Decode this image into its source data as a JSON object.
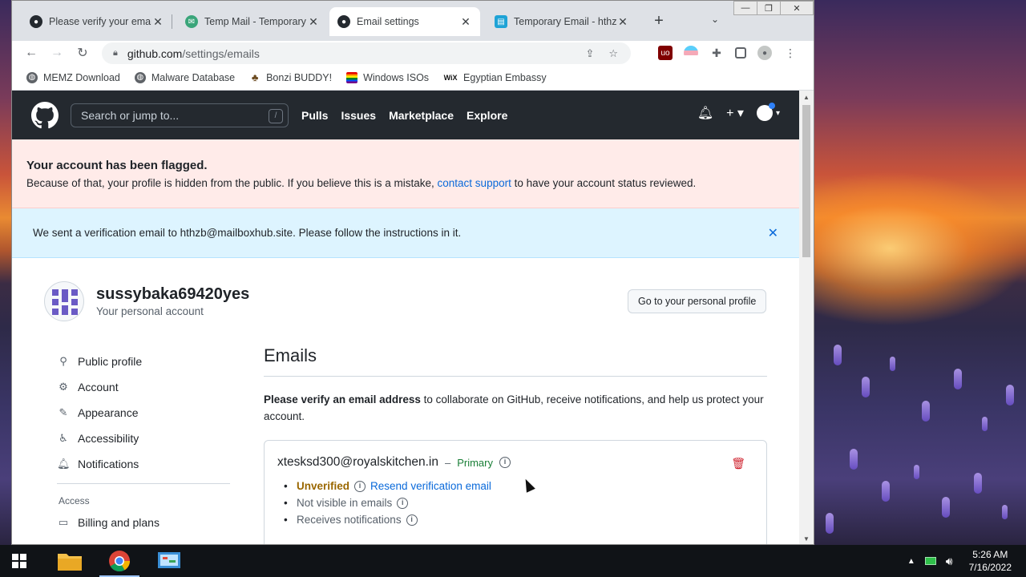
{
  "tabs": [
    {
      "title": "Please verify your email",
      "icon": "github-icon"
    },
    {
      "title": "Temp Mail - Temporary Email",
      "icon": "tempmail-icon"
    },
    {
      "title": "Email settings",
      "icon": "github-icon",
      "active": true
    },
    {
      "title": "Temporary Email - hthzb",
      "icon": "tempemail-icon"
    }
  ],
  "omnibox": {
    "host": "github.com",
    "path": "/settings/emails"
  },
  "bookmarks": [
    {
      "label": "MEMZ Download"
    },
    {
      "label": "Malware Database"
    },
    {
      "label": "Bonzi BUDDY!"
    },
    {
      "label": "Windows ISOs"
    },
    {
      "label": "Egyptian Embassy"
    }
  ],
  "gh_header": {
    "search_placeholder": "Search or jump to...",
    "search_key": "/",
    "nav": [
      "Pulls",
      "Issues",
      "Marketplace",
      "Explore"
    ]
  },
  "flash_error": {
    "title": "Your account has been flagged.",
    "msg_before": "Because of that, your profile is hidden from the public. If you believe this is a mistake,",
    "link": "contact support",
    "msg_after": "to have your account status reviewed."
  },
  "flash_info": {
    "message": "We sent a verification email to hthzb@mailboxhub.site. Please follow the instructions in it."
  },
  "account": {
    "username": "sussybaka69420yes",
    "subtitle": "Your personal account",
    "profile_button": "Go to your personal profile"
  },
  "sidenav": {
    "items": [
      "Public profile",
      "Account",
      "Appearance",
      "Accessibility",
      "Notifications"
    ],
    "section": "Access",
    "access_items": [
      "Billing and plans"
    ]
  },
  "main": {
    "title": "Emails",
    "verify_bold": "Please verify an email address",
    "verify_rest": "to collaborate on GitHub, receive notifications, and help us protect your account.",
    "email": {
      "address": "xtesksd300@royalskitchen.in",
      "dash": "–",
      "badge": "Primary",
      "status": "Unverified",
      "resend": "Resend verification email",
      "bullets": [
        "Not visible in emails",
        "Receives notifications"
      ]
    }
  },
  "taskbar": {
    "time": "5:26 AM",
    "date": "7/16/2022"
  },
  "colors": {
    "github_dark": "#24292f",
    "link": "#0969da",
    "danger": "#cf222e",
    "success": "#1a7f37",
    "warning": "#9a6700"
  }
}
